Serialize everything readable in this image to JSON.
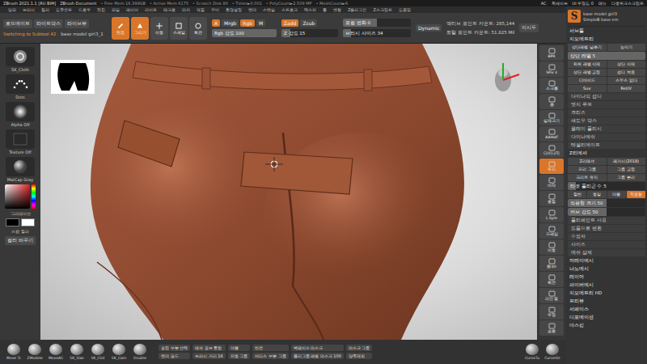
{
  "title_bar": {
    "texts": [
      "ZBrush 2021.1.1 [RU BIM]",
      "ZBrush Document",
      "• Free Mem 16.399GB",
      "• Active Mem 6175",
      "• Scratch Disk 80",
      "• Timer►0.001",
      "• PolyCount►2.509 MP",
      "• MeshCount►6"
    ],
    "right": [
      "AC",
      "퀵세이브",
      "UI 투명도 0",
      "메뉴",
      "다중위크스크립트"
    ]
  },
  "menu": [
    "알파",
    "브러시",
    "컬러",
    "도큐먼트",
    "드로우",
    "편집",
    "파일",
    "레이어",
    "라이트",
    "매크로",
    "마커",
    "재질",
    "무비",
    "환경설정",
    "렌더",
    "스텐실",
    "스트로크",
    "텍스처",
    "툴",
    "변형",
    "Z플러그인",
    "Z스크립트",
    "도움말"
  ],
  "toolbar": {
    "quick_buttons": [
      "로드메이트",
      "라이트박스",
      "라이브뷰"
    ],
    "status": [
      "Switching to Subtool 42",
      "base model girl3_1"
    ],
    "transform": [
      {
        "label": "편집",
        "selected": true
      },
      {
        "label": "그리기",
        "selected": true
      },
      {
        "label": "이동",
        "selected": false
      },
      {
        "label": "스케일",
        "selected": false
      },
      {
        "label": "회전",
        "selected": false
      }
    ],
    "color_modes": [
      {
        "label": "A",
        "selected": true
      },
      {
        "label": "Mrgb",
        "selected": false
      },
      {
        "label": "Rgb",
        "selected": true
      },
      {
        "label": "M",
        "selected": false
      }
    ],
    "rgb_slider": {
      "label": "Rgb 강도 100",
      "level": 1
    },
    "z_modes": [
      {
        "label": "Zadd",
        "selected": true
      },
      {
        "label": "Zsub",
        "selected": false
      }
    ],
    "z_slider": {
      "label": "Z 강도 15",
      "level": 0.15
    },
    "focal_slider": {
      "label": "포컬 변화 0",
      "level": 0.5
    },
    "size_slider": {
      "label": "브러시 사이즈 34",
      "level": 0.12
    },
    "dynamic": "Dynamic",
    "counts": [
      "액티브 포인트 카운트: 285,144",
      "토탈 포인트 카운트: 51.825 Mil"
    ],
    "extra": "이시두"
  },
  "palette": {
    "items": [
      {
        "label": "SK_Cloth",
        "kind": "brush"
      },
      {
        "label": "Dots",
        "kind": "stroke"
      },
      {
        "label": "Alpha Off",
        "kind": "alpha"
      },
      {
        "label": "Texture Off",
        "kind": "texture"
      },
      {
        "label": "MatCap Gray",
        "kind": "material"
      }
    ],
    "colors": {
      "main": "#000000",
      "secondary": "#ffffff"
    },
    "labels": [
      "그라데이션",
      "스왑 컬러",
      "컬러 바꾸기"
    ]
  },
  "view_tools": [
    {
      "label": "BPR",
      "selected": false
    },
    {
      "label": "SPix 3",
      "selected": false
    },
    {
      "label": "스크롤",
      "selected": false
    },
    {
      "label": "줌",
      "selected": false
    },
    {
      "label": "실제크기",
      "selected": false
    },
    {
      "label": "AAHalf",
      "selected": false
    },
    {
      "label": "다이나믹",
      "selected": false
    },
    {
      "label": "투시",
      "selected": true
    },
    {
      "label": "바닥",
      "selected": false
    },
    {
      "label": "로컬",
      "selected": false
    },
    {
      "label": "L.Sym",
      "selected": false
    },
    {
      "label": "프레임",
      "selected": false
    },
    {
      "label": "이동",
      "selected": false
    },
    {
      "label": "줌3D",
      "selected": false
    },
    {
      "label": "회전",
      "selected": false
    },
    {
      "label": "라인 필",
      "selected": false
    },
    {
      "label": "투명",
      "selected": false
    },
    {
      "label": "솔로",
      "selected": false
    }
  ],
  "right_panel": {
    "logo": "S",
    "names": [
      "base model girl3",
      "SimpleB base em"
    ],
    "rows": [
      {
        "kind": "header",
        "label": "서브툴"
      },
      {
        "kind": "header",
        "label": "지오메트리"
      },
      {
        "kind": "row",
        "buttons": [
          {
            "label": "상단레벨 낮추기",
            "selected": false
          },
          {
            "label": "높이기",
            "selected": false
          }
        ]
      },
      {
        "kind": "slider",
        "label": "상단 레벨 5",
        "level": 1
      },
      {
        "kind": "row",
        "buttons": [
          {
            "label": "하위 레벨 삭제",
            "selected": false
          },
          {
            "label": "상단 삭제",
            "selected": false
          }
        ]
      },
      {
        "kind": "row",
        "buttons": [
          {
            "label": "상단 레벨 고정",
            "selected": false
          },
          {
            "label": "섭디 복원",
            "selected": false
          }
        ]
      },
      {
        "kind": "row",
        "buttons": [
          {
            "label": "디바이드",
            "selected": false
          },
          {
            "label": "스무스 없다",
            "selected": false
          }
        ]
      },
      {
        "kind": "row",
        "buttons": [
          {
            "label": "Suv",
            "selected": false
          },
          {
            "label": "ReUV",
            "selected": false
          }
        ]
      },
      {
        "kind": "item",
        "label": "다이나믹 섭디"
      },
      {
        "kind": "item",
        "label": "엣지 루프"
      },
      {
        "kind": "item",
        "label": "크리즈"
      },
      {
        "kind": "item",
        "label": "섀도우 박스"
      },
      {
        "kind": "item",
        "label": "클레이 폴리시"
      },
      {
        "kind": "item",
        "label": "다이나메쉬"
      },
      {
        "kind": "item",
        "label": "테셀리메이트"
      },
      {
        "kind": "header",
        "label": "Z리메셔"
      },
      {
        "kind": "row",
        "buttons": [
          {
            "label": "Z리메셔",
            "selected": false
          },
          {
            "label": "레거시(2018)",
            "selected": false
          }
        ]
      },
      {
        "kind": "row",
        "buttons": [
          {
            "label": "프리 그룹",
            "selected": false
          },
          {
            "label": "그룹 고정",
            "selected": false
          }
        ]
      },
      {
        "kind": "row",
        "buttons": [
          {
            "label": "크리즈 유지",
            "selected": false
          },
          {
            "label": "그룹 분리",
            "selected": false
          }
        ]
      },
      {
        "kind": "slider",
        "label": "타겟 폴리곤 수 5",
        "level": 0.1
      },
      {
        "kind": "row",
        "buttons": [
          {
            "label": "절반",
            "selected": false
          },
          {
            "label": "동일",
            "selected": false
          },
          {
            "label": "더블",
            "selected": false
          },
          {
            "label": "적응형",
            "selected": true
          }
        ]
      },
      {
        "kind": "slider",
        "label": "적응형 크기 50",
        "level": 0.5
      },
      {
        "kind": "slider",
        "label": "커브 강도 50",
        "level": 0.5
      },
      {
        "kind": "item",
        "label": "폴리페인트 사용"
      },
      {
        "kind": "item",
        "label": "도움으로 변환"
      },
      {
        "kind": "item",
        "label": "수정자"
      },
      {
        "kind": "item",
        "label": "사이즈"
      },
      {
        "kind": "item",
        "label": "메쉬 삼제"
      },
      {
        "kind": "header",
        "label": "어레이메시"
      },
      {
        "kind": "header",
        "label": "나노메시"
      },
      {
        "kind": "header",
        "label": "레이어"
      },
      {
        "kind": "header",
        "label": "파이버메시"
      },
      {
        "kind": "header",
        "label": "지오메트리 HD"
      },
      {
        "kind": "header",
        "label": "프리뷰"
      },
      {
        "kind": "header",
        "label": "서페이스"
      },
      {
        "kind": "header",
        "label": "디포메이션"
      },
      {
        "kind": "header",
        "label": "마스킹"
      }
    ]
  },
  "bottom_bar": {
    "brushes": [
      "Move Tc",
      "ZModele",
      "MoveAC",
      "SK_Slas",
      "SK_Clot",
      "SK_Cam",
      "Double"
    ],
    "options": [
      {
        "label": "송점 부분 선택",
        "selected": false
      },
      {
        "label": "메쉬 오브 통합",
        "selected": false
      },
      {
        "label": "더블",
        "selected": false
      },
      {
        "label": "반전",
        "selected": false
      },
      {
        "label": "백페이스 마스크",
        "selected": false
      },
      {
        "label": "마스크 그룹",
        "selected": false
      },
      {
        "label": "렌더 모드",
        "selected": false
      },
      {
        "label": "브러시 거리 16",
        "selected": false
      },
      {
        "label": "자동 그룹",
        "selected": false
      },
      {
        "label": "버티스 부분 그룹",
        "selected": false
      },
      {
        "label": "폴리그룹 레벨 마스크 100",
        "selected": false
      },
      {
        "label": "양쪽제외",
        "selected": false
      }
    ],
    "curves": [
      "CurveTu",
      "CurveStr"
    ]
  }
}
